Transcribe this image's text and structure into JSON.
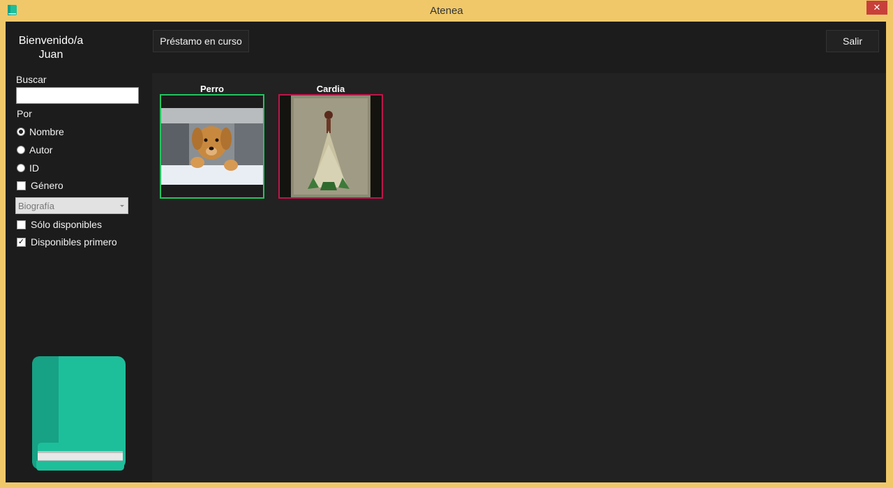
{
  "window": {
    "title": "Atenea",
    "close_glyph": "✕",
    "app_icon": "book-icon"
  },
  "sidebar": {
    "welcome_line1": "Bienvenido/a",
    "welcome_line2": "Juan",
    "search_label": "Buscar",
    "search_value": "",
    "by_label": "Por",
    "radio_options": [
      {
        "label": "Nombre",
        "checked": true
      },
      {
        "label": "Autor",
        "checked": false
      },
      {
        "label": "ID",
        "checked": false
      }
    ],
    "genre_checkbox": {
      "label": "Género",
      "checked": false
    },
    "genre_select": {
      "value": "Biografía",
      "enabled": false
    },
    "only_available": {
      "label": "Sólo disponibles",
      "checked": false
    },
    "available_first": {
      "label": "Disponibles primero",
      "checked": true
    }
  },
  "toolbar": {
    "loan_button": "Préstamo en curso",
    "exit_button": "Salir"
  },
  "books": [
    {
      "title": "Perro",
      "available": true,
      "cover": "dog-photo"
    },
    {
      "title": "Cardia",
      "available": false,
      "cover": "illustration-cover"
    }
  ],
  "colors": {
    "available": "#22c55e",
    "unavailable": "#c0144a",
    "logo": "#1dbf9b",
    "frame": "#f0c86a"
  }
}
